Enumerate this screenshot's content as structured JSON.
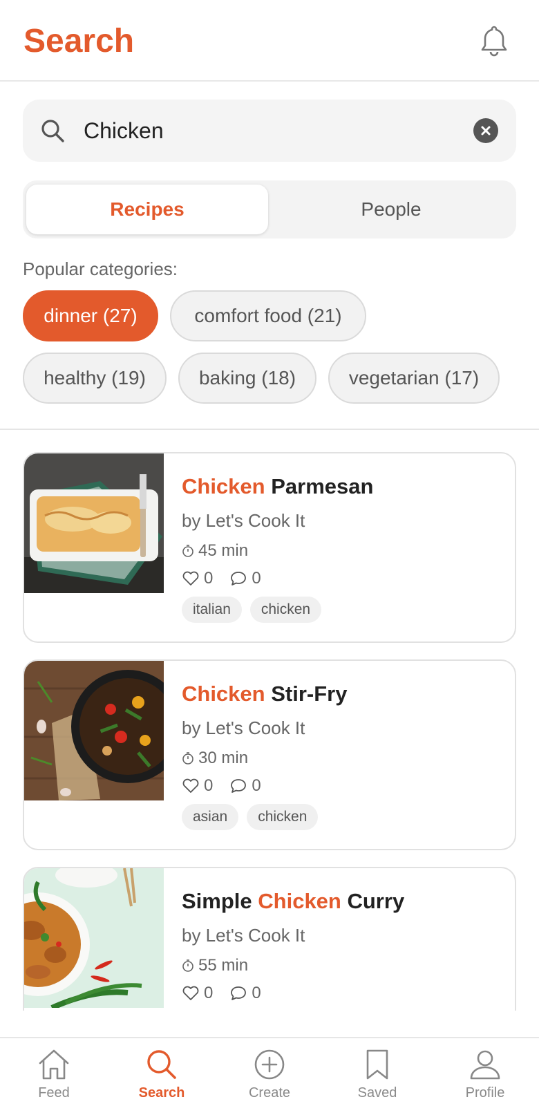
{
  "header": {
    "title": "Search",
    "bell_icon": "bell-icon"
  },
  "search": {
    "value": "Chicken",
    "icon": "search-icon",
    "clear_icon": "clear-icon"
  },
  "tabs": [
    {
      "label": "Recipes",
      "active": true
    },
    {
      "label": "People",
      "active": false
    }
  ],
  "categories": {
    "title": "Popular categories:",
    "chips": [
      {
        "label": "dinner (27)",
        "active": true
      },
      {
        "label": "comfort food (21)",
        "active": false
      },
      {
        "label": "healthy (19)",
        "active": false
      },
      {
        "label": "baking (18)",
        "active": false
      },
      {
        "label": "vegetarian (17)",
        "active": false
      }
    ]
  },
  "recipes": [
    {
      "title_pre": "",
      "title_hl": "Chicken",
      "title_post": " Parmesan",
      "author": "by Let's Cook It",
      "time": "45 min",
      "likes": "0",
      "comments": "0",
      "tags": [
        "italian",
        "chicken"
      ]
    },
    {
      "title_pre": "",
      "title_hl": "Chicken",
      "title_post": " Stir-Fry",
      "author": "by Let's Cook It",
      "time": "30 min",
      "likes": "0",
      "comments": "0",
      "tags": [
        "asian",
        "chicken"
      ]
    },
    {
      "title_pre": "Simple ",
      "title_hl": "Chicken",
      "title_post": " Curry",
      "author": "by Let's Cook It",
      "time": "55 min",
      "likes": "0",
      "comments": "0",
      "tags": [
        "",
        ""
      ]
    }
  ],
  "nav": [
    {
      "label": "Feed",
      "icon": "home-icon",
      "active": false
    },
    {
      "label": "Search",
      "icon": "search-icon",
      "active": true
    },
    {
      "label": "Create",
      "icon": "plus-circle-icon",
      "active": false
    },
    {
      "label": "Saved",
      "icon": "bookmark-icon",
      "active": false
    },
    {
      "label": "Profile",
      "icon": "person-icon",
      "active": false
    }
  ],
  "colors": {
    "accent": "#E35A2C",
    "chip_bg": "#F2F2F2",
    "text": "#222222",
    "muted": "#666666"
  }
}
